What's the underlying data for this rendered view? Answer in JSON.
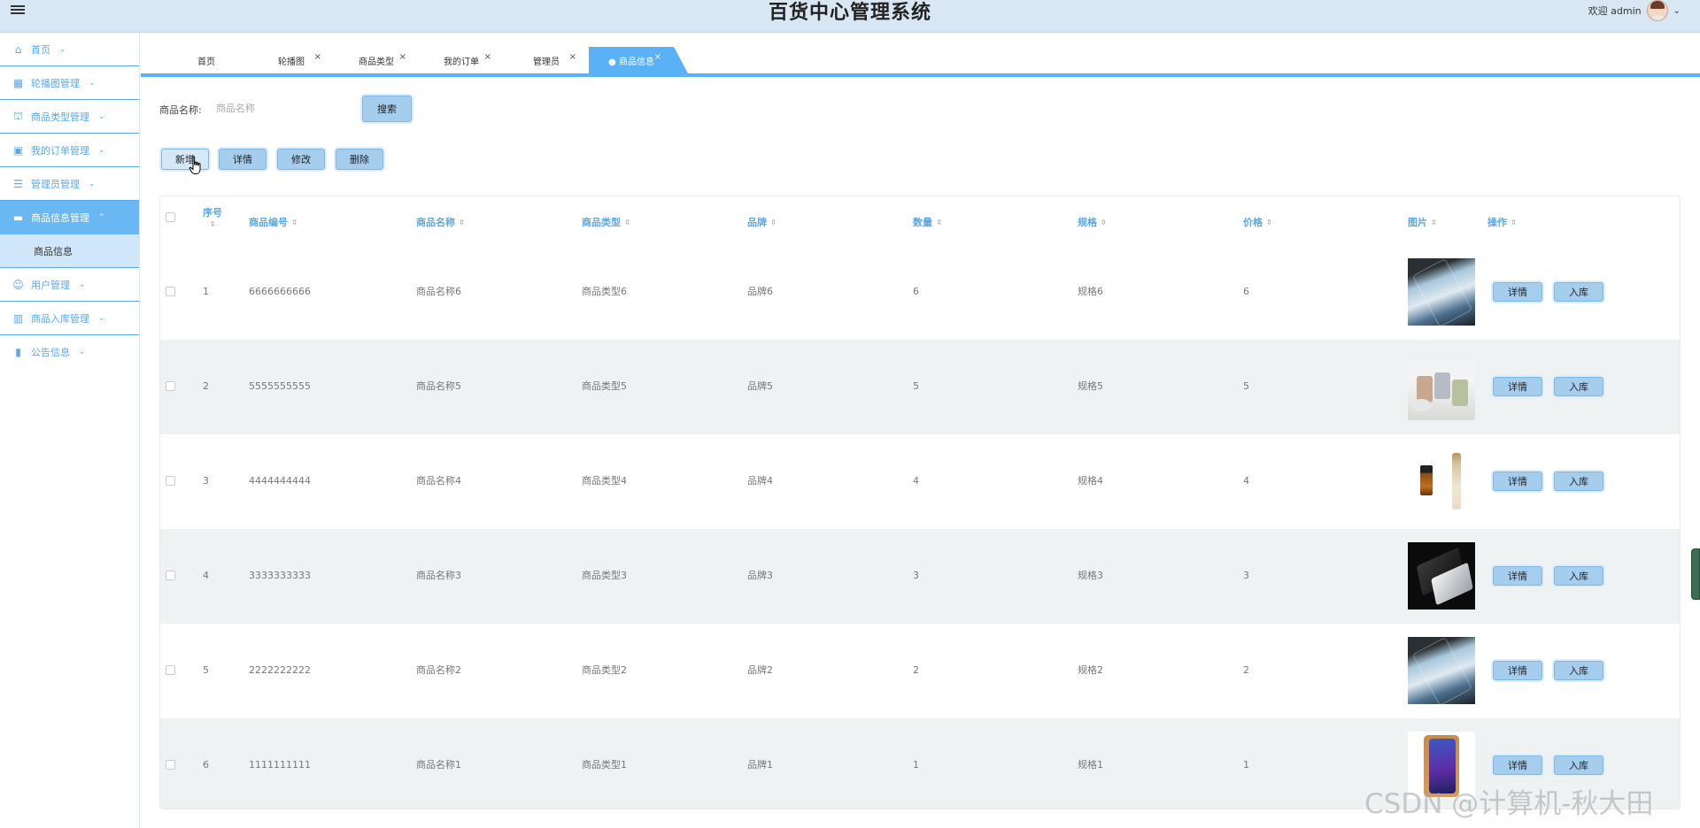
{
  "header": {
    "title": "百货中心管理系统",
    "welcome": "欢迎 admin"
  },
  "sidebar": {
    "items": [
      {
        "label": "首页",
        "icon": "home-icon"
      },
      {
        "label": "轮播图管理",
        "icon": "layout-icon"
      },
      {
        "label": "商品类型管理",
        "icon": "shop-icon"
      },
      {
        "label": "我的订单管理",
        "icon": "gift-icon"
      },
      {
        "label": "管理员管理",
        "icon": "list-icon"
      },
      {
        "label": "商品信息管理",
        "icon": "briefcase-icon",
        "active": true
      },
      {
        "label": "用户管理",
        "icon": "user-icon"
      },
      {
        "label": "商品入库管理",
        "icon": "building-icon"
      },
      {
        "label": "公告信息",
        "icon": "book-icon"
      }
    ],
    "submenu": {
      "label": "商品信息"
    }
  },
  "tabs": [
    {
      "label": "首页"
    },
    {
      "label": "轮播图"
    },
    {
      "label": "商品类型"
    },
    {
      "label": "我的订单"
    },
    {
      "label": "管理员"
    },
    {
      "label": "● 商品信息",
      "active": true
    }
  ],
  "search": {
    "label": "商品名称:",
    "placeholder": "商品名称",
    "button": "搜索"
  },
  "toolbar": {
    "add": "新增",
    "detail": "详情",
    "edit": "修改",
    "delete": "删除"
  },
  "table": {
    "columns": [
      "序号",
      "商品编号",
      "商品名称",
      "商品类型",
      "品牌",
      "数量",
      "规格",
      "价格",
      "图片",
      "操作"
    ],
    "action_detail": "详情",
    "action_stock": "入库",
    "rows": [
      {
        "no": "1",
        "code": "6666666666",
        "name": "商品名称6",
        "type": "商品类型6",
        "brand": "品牌6",
        "qty": "6",
        "spec": "规格6",
        "price": "6",
        "image": "phone-blue"
      },
      {
        "no": "2",
        "code": "5555555555",
        "name": "商品名称5",
        "type": "商品类型5",
        "brand": "品牌5",
        "qty": "5",
        "spec": "规格5",
        "price": "5",
        "image": "cups"
      },
      {
        "no": "3",
        "code": "4444444444",
        "name": "商品名称4",
        "type": "商品类型4",
        "brand": "品牌4",
        "qty": "4",
        "spec": "规格4",
        "price": "4",
        "image": "cosmetic"
      },
      {
        "no": "4",
        "code": "3333333333",
        "name": "商品名称3",
        "type": "商品类型3",
        "brand": "品牌3",
        "qty": "3",
        "spec": "规格3",
        "price": "3",
        "image": "phone-black"
      },
      {
        "no": "5",
        "code": "2222222222",
        "name": "商品名称2",
        "type": "商品类型2",
        "brand": "品牌2",
        "qty": "2",
        "spec": "规格2",
        "price": "2",
        "image": "phone-blue"
      },
      {
        "no": "6",
        "code": "1111111111",
        "name": "商品名称1",
        "type": "商品类型1",
        "brand": "品牌1",
        "qty": "1",
        "spec": "规格1",
        "price": "1",
        "image": "phone-orange"
      }
    ]
  },
  "watermark": "CSDN @计算机-秋大田",
  "colors": {
    "accent": "#5ab1f5",
    "header_bg": "#d9e6f3",
    "button_bg": "#a5cdee",
    "row_alt": "#eef2f3"
  }
}
